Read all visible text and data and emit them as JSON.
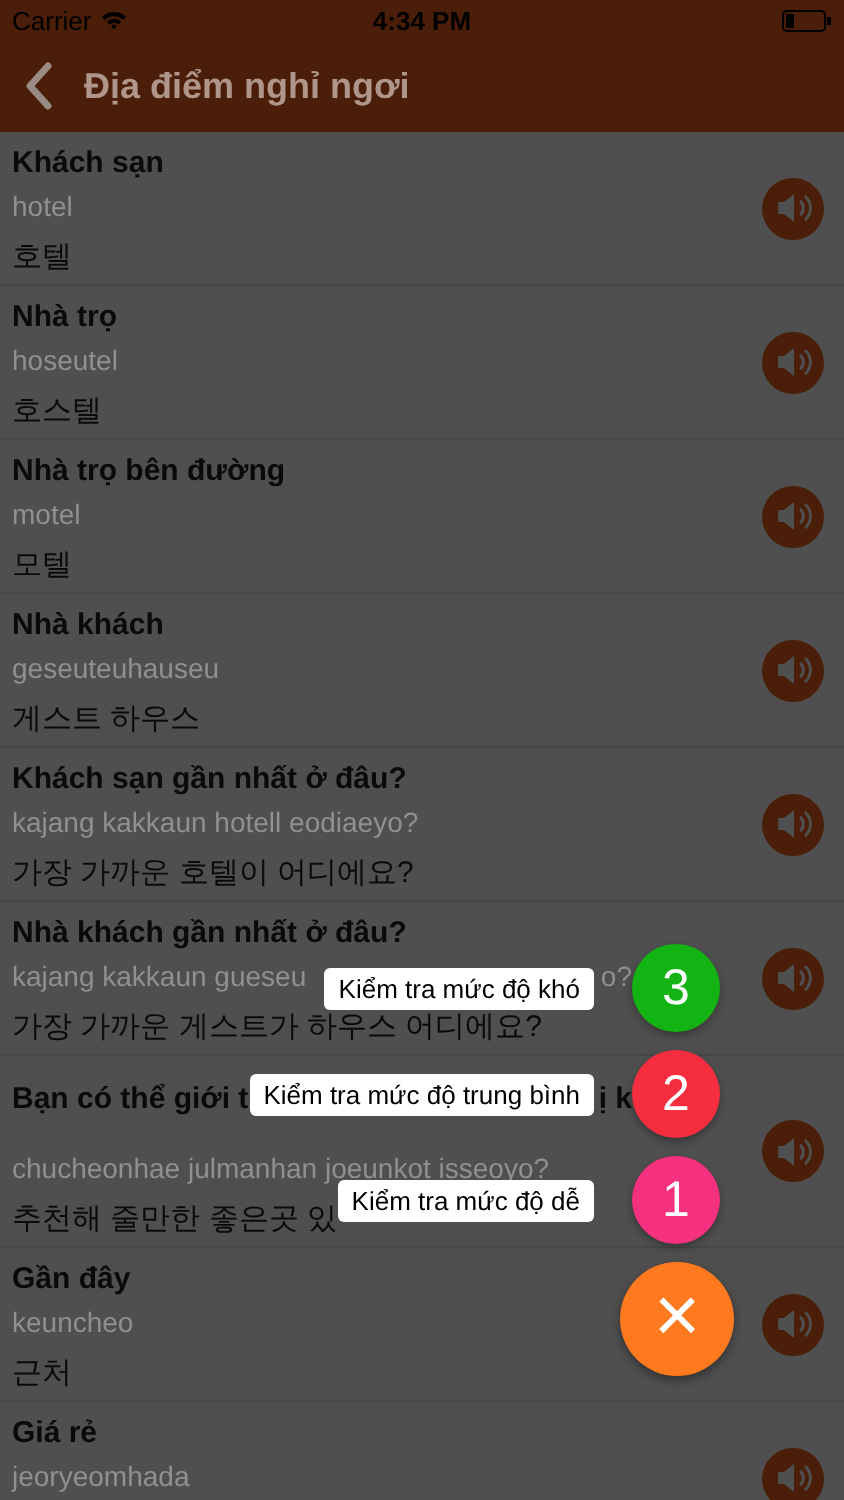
{
  "status_bar": {
    "carrier": "Carrier",
    "time": "4:34 PM"
  },
  "nav": {
    "title": "Địa điểm nghỉ ngơi"
  },
  "phrases": [
    {
      "vietnamese": "Khách sạn",
      "romanization": "hotel",
      "korean": "호텔"
    },
    {
      "vietnamese": "Nhà trọ",
      "romanization": "hoseutel",
      "korean": "호스텔"
    },
    {
      "vietnamese": "Nhà trọ bên đường",
      "romanization": "motel",
      "korean": "모텔"
    },
    {
      "vietnamese": "Nhà khách",
      "romanization": "geseuteuhauseu",
      "korean": "게스트 하우스"
    },
    {
      "vietnamese": "Khách sạn gần nhất ở đâu?",
      "romanization": "kajang kakkaun hotell eodiaeyo?",
      "korean": "가장 가까운 호텔이 어디에요?"
    },
    {
      "vietnamese": "Nhà khách gần nhất ở đâu?",
      "romanization": "kajang kakkaun gueseu",
      "romanization_tail": "o?",
      "korean": "가장 가까운 게스트가 하우스 어디에요?"
    },
    {
      "vietnamese": "Bạn có thể giới t",
      "vietnamese_tail": "ị k",
      "romanization": "chucheonhae julmanhan joeunkot isseoyo?",
      "korean": "추천해 줄만한 좋은곳 있"
    },
    {
      "vietnamese": "Gần đây",
      "romanization": "keuncheo",
      "korean": "근처"
    },
    {
      "vietnamese": "Giá rẻ",
      "romanization": "jeoryeomhada"
    }
  ],
  "speed_dial": {
    "options": [
      {
        "label": "Kiểm tra mức độ khó",
        "number": "3",
        "color": "#12b312"
      },
      {
        "label": "Kiểm tra mức độ trung bình",
        "number": "2",
        "color": "#f52e3f"
      },
      {
        "label": "Kiểm tra mức độ dễ",
        "number": "1",
        "color": "#f5307e"
      }
    ],
    "close": "×"
  }
}
